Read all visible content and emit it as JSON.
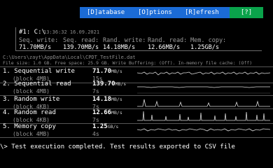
{
  "menu": {
    "database": {
      "key": "[D]",
      "rest": "atabase"
    },
    "options": {
      "key": "[O]",
      "rest": "ptions"
    },
    "refresh": {
      "key": "[R]",
      "rest": "efresh"
    },
    "help": "[?]"
  },
  "summary": {
    "id": "#1: C:\\",
    "datetime": "13:36:32 16.09.2021",
    "headers": [
      "Seq. write:",
      "Seq. read:",
      "Rand. write:",
      "Rand. read:",
      "Mem. copy:"
    ],
    "values": [
      "71.70MB/s",
      "139.70MB/s",
      "14.18MB/s",
      "12.66MB/s",
      "1.25GB/s"
    ]
  },
  "file_path": "C:\\Users\\zayt\\AppData\\Local\\CPDT_TestFile.dat",
  "file_info": "File size: 1.0 GB. Free space: 25.9 GB. Write Buffering: (Off). In-memory file cache: (Off)",
  "tests": [
    {
      "name": "1. Sequential write",
      "block": "(block 4MB)",
      "value": "71.70",
      "unit": "MB/s",
      "time": "15s"
    },
    {
      "name": "2. Sequential read",
      "block": "(block 4MB)",
      "value": "139.70",
      "unit": "MB/s",
      "time": "7s"
    },
    {
      "name": "3. Random write",
      "block": "(block 4KB)",
      "value": "14.18",
      "unit": "MB/s",
      "time": "7s"
    },
    {
      "name": "4. Random read",
      "block": "(block 4KB)",
      "value": "12.66",
      "unit": "MB/s",
      "time": "7s"
    },
    {
      "name": "5. Memory copy",
      "block": "(block 4MB)",
      "value": "1.25",
      "unit": "GB/s",
      "time": "4s"
    }
  ],
  "status": "\\> Test execution completed. Test results exported to CSV file"
}
